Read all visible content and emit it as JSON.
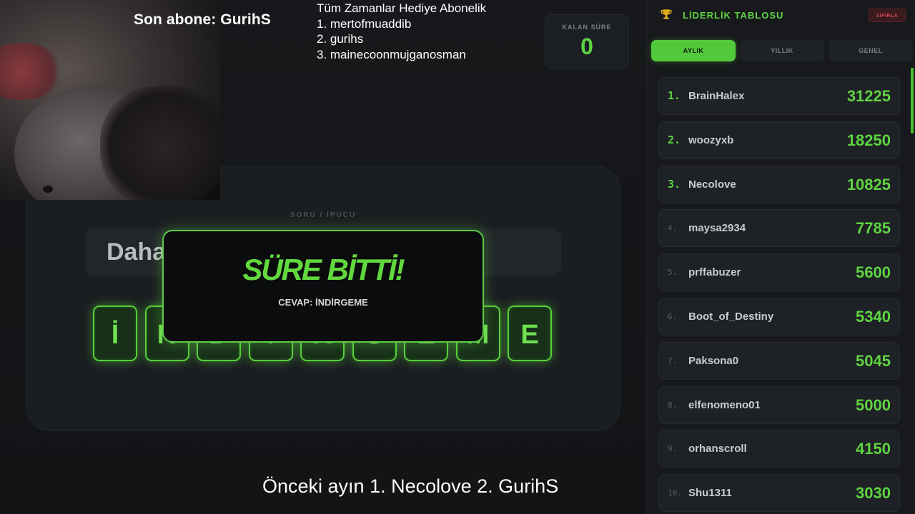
{
  "overlay": {
    "last_subscriber": "Son abone: GurihS",
    "alltime_title": "Tüm Zamanlar Hediye  Abonelik",
    "alltime_list": [
      "1. mertofmuaddib",
      "2. gurihs",
      "3. mainecoonmujganosman"
    ],
    "previous_month": "Önceki ayın 1. Necolove 2. GurihS"
  },
  "timer": {
    "label": "KALAN SÜRE",
    "value": "0"
  },
  "question": {
    "label": "SORU / İPUCU",
    "clue": "Daha basit hale getirme, azaltma",
    "letters": [
      "İ",
      "N",
      "D",
      "İ",
      "R",
      "G",
      "E",
      "M",
      "E"
    ]
  },
  "modal": {
    "title": "SÜRE BİTTİ!",
    "answer": "CEVAP: İNDİRGEME"
  },
  "leaderboard": {
    "title": "LİDERLİK TABLOSU",
    "reset_label": "SIFIRLA",
    "tabs": [
      {
        "label": "AYLIK",
        "active": true
      },
      {
        "label": "YILLIK",
        "active": false
      },
      {
        "label": "GENEL",
        "active": false
      }
    ],
    "rows": [
      {
        "rank": "1.",
        "name": "BrainHalex",
        "score": "31225"
      },
      {
        "rank": "2.",
        "name": "woozyxb",
        "score": "18250"
      },
      {
        "rank": "3.",
        "name": "Necolove",
        "score": "10825"
      },
      {
        "rank": "4.",
        "name": "maysa2934",
        "score": "7785"
      },
      {
        "rank": "5.",
        "name": "prffabuzer",
        "score": "5600"
      },
      {
        "rank": "6.",
        "name": "Boot_of_Destiny",
        "score": "5340"
      },
      {
        "rank": "7.",
        "name": "Paksona0",
        "score": "5045"
      },
      {
        "rank": "8.",
        "name": "elfenomeno01",
        "score": "5000"
      },
      {
        "rank": "9.",
        "name": "orhanscroll",
        "score": "4150"
      },
      {
        "rank": "10.",
        "name": "Shu1311",
        "score": "3030"
      }
    ]
  },
  "colors": {
    "accent": "#5fd342",
    "background": "#131517",
    "danger": "#d24b52"
  },
  "icons": {
    "leaderboard": "trophy-icon"
  }
}
